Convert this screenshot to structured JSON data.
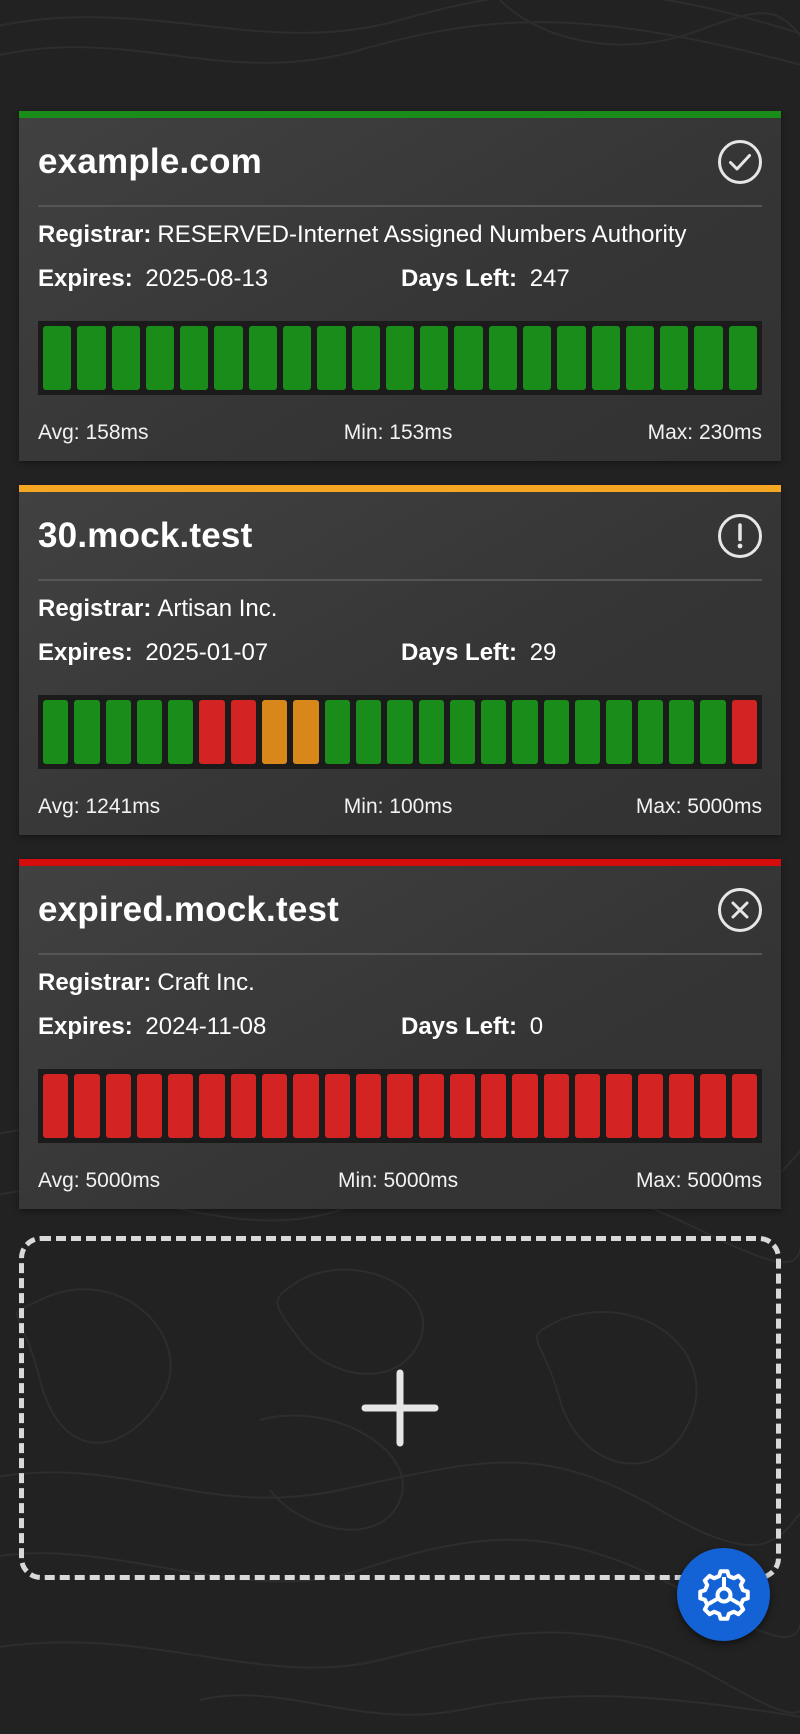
{
  "labels": {
    "registrar": "Registrar:",
    "expires": "Expires:",
    "days_left": "Days Left:"
  },
  "colors": {
    "ok": "#1a8c1a",
    "warn": "#d8871a",
    "error": "#d42323",
    "header_ok": "#1a8c1a",
    "header_warn": "#f5a623",
    "header_error": "#d40c0c",
    "fab": "#1463d6"
  },
  "domains": [
    {
      "name": "example.com",
      "status": "ok",
      "status_icon": "check-circle-icon",
      "registrar": "RESERVED-Internet Assigned Numbers Authority",
      "expires": "2025-08-13",
      "days_left": "247",
      "history": [
        "ok",
        "ok",
        "ok",
        "ok",
        "ok",
        "ok",
        "ok",
        "ok",
        "ok",
        "ok",
        "ok",
        "ok",
        "ok",
        "ok",
        "ok",
        "ok",
        "ok",
        "ok",
        "ok",
        "ok",
        "ok"
      ],
      "avg": "Avg: 158ms",
      "min": "Min: 153ms",
      "max": "Max: 230ms"
    },
    {
      "name": "30.mock.test",
      "status": "warn",
      "status_icon": "exclamation-circle-icon",
      "registrar": "Artisan Inc.",
      "expires": "2025-01-07",
      "days_left": "29",
      "history": [
        "ok",
        "ok",
        "ok",
        "ok",
        "ok",
        "error",
        "error",
        "warn",
        "warn",
        "ok",
        "ok",
        "ok",
        "ok",
        "ok",
        "ok",
        "ok",
        "ok",
        "ok",
        "ok",
        "ok",
        "ok",
        "ok",
        "error"
      ],
      "avg": "Avg: 1241ms",
      "min": "Min: 100ms",
      "max": "Max: 5000ms"
    },
    {
      "name": "expired.mock.test",
      "status": "error",
      "status_icon": "x-circle-icon",
      "registrar": "Craft Inc.",
      "expires": "2024-11-08",
      "days_left": "0",
      "history": [
        "error",
        "error",
        "error",
        "error",
        "error",
        "error",
        "error",
        "error",
        "error",
        "error",
        "error",
        "error",
        "error",
        "error",
        "error",
        "error",
        "error",
        "error",
        "error",
        "error",
        "error",
        "error",
        "error"
      ],
      "avg": "Avg: 5000ms",
      "min": "Min: 5000ms",
      "max": "Max: 5000ms"
    }
  ],
  "add_card": {
    "icon": "plus-icon"
  },
  "fab": {
    "icon": "gear-icon"
  }
}
